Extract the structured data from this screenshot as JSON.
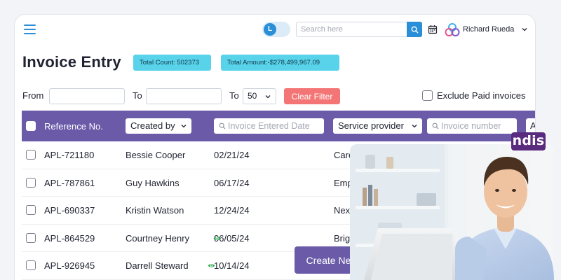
{
  "header": {
    "toggle_letter": "L",
    "search_placeholder": "Search here",
    "user_name": "Richard Rueda",
    "icons": [
      "menu-icon",
      "search-icon",
      "calendar-icon",
      "chevron-down-icon"
    ]
  },
  "page": {
    "title": "Invoice Entry",
    "total_count": "Total Count: 502373",
    "total_amount": "Total Amount:-$278,499,967.09"
  },
  "filters": {
    "from_label": "From",
    "to_label": "To",
    "to_label_2": "To",
    "page_size": "50",
    "clear_label": "Clear Filter",
    "exclude_label": "Exclude Paid invoices"
  },
  "table": {
    "headers": {
      "reference": "Reference  No.",
      "created_by": "Created by",
      "date_placeholder": "Invoice Entered Date",
      "service_provider": "Service provider",
      "invoice_placeholder": "Invoice number",
      "partial": "A"
    },
    "rows": [
      {
        "ref": "APL-721180",
        "by": "Bessie Cooper",
        "date": "02/21/24",
        "sp": "Care"
      },
      {
        "ref": "APL-787861",
        "by": "Guy Hawkins",
        "date": "06/17/24",
        "sp": "Emp"
      },
      {
        "ref": "APL-690337",
        "by": "Kristin Watson",
        "date": "12/24/24",
        "sp": "Next"
      },
      {
        "ref": "APL-864529",
        "by": "Courtney Henry",
        "date": "06/05/24",
        "sp": "Brig"
      },
      {
        "ref": "APL-926945",
        "by": "Darrell Steward",
        "date": "10/14/24",
        "sp": ""
      }
    ]
  },
  "actions": {
    "create_label": "Create New"
  },
  "overlay": {
    "logo_text": "ndis"
  },
  "colors": {
    "accent": "#2b8fd8",
    "header_bg": "#6a5aa8",
    "badge_bg": "#58d3ea",
    "danger": "#f47575",
    "logo_bg": "#5a2a7e"
  }
}
